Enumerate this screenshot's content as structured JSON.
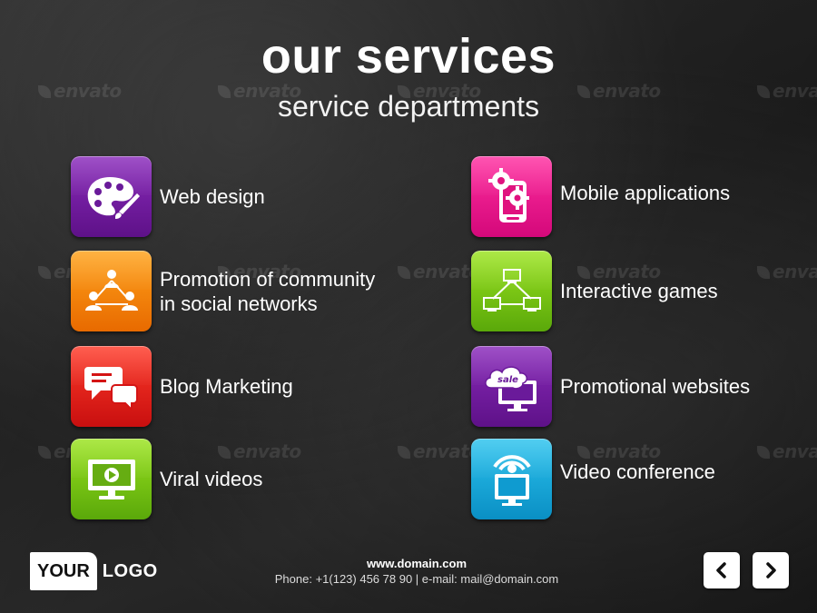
{
  "header": {
    "title": "our services",
    "subtitle": "service departments"
  },
  "watermark": "envato",
  "services": [
    {
      "label": "Web design",
      "icon": "palette-icon",
      "color": "#7a1fae"
    },
    {
      "label": "Promotion of community\nin social networks",
      "icon": "social-network-icon",
      "color": "#f7890c"
    },
    {
      "label": "Blog Marketing",
      "icon": "speech-bubbles-icon",
      "color": "#ee1e1e"
    },
    {
      "label": "Viral videos",
      "icon": "video-screen-icon",
      "color": "#7ccc14"
    },
    {
      "label": "Mobile applications",
      "icon": "phone-gears-icon",
      "color": "#ee1490"
    },
    {
      "label": "Interactive games",
      "icon": "network-computers-icon",
      "color": "#7ccc14"
    },
    {
      "label": "Promotional websites",
      "icon": "sale-cloud-monitor-icon",
      "color": "#7a1fae"
    },
    {
      "label": "Video conference",
      "icon": "conference-screen-icon",
      "color": "#18aee0"
    }
  ],
  "logo": {
    "boxed": "YOUR",
    "text": "LOGO"
  },
  "footer": {
    "domain": "www.domain.com",
    "contact": "Phone: +1(123) 456 78 90 | e-mail: mail@domain.com"
  },
  "nav": {
    "prev_icon": "chevron-left-icon",
    "next_icon": "chevron-right-icon"
  }
}
